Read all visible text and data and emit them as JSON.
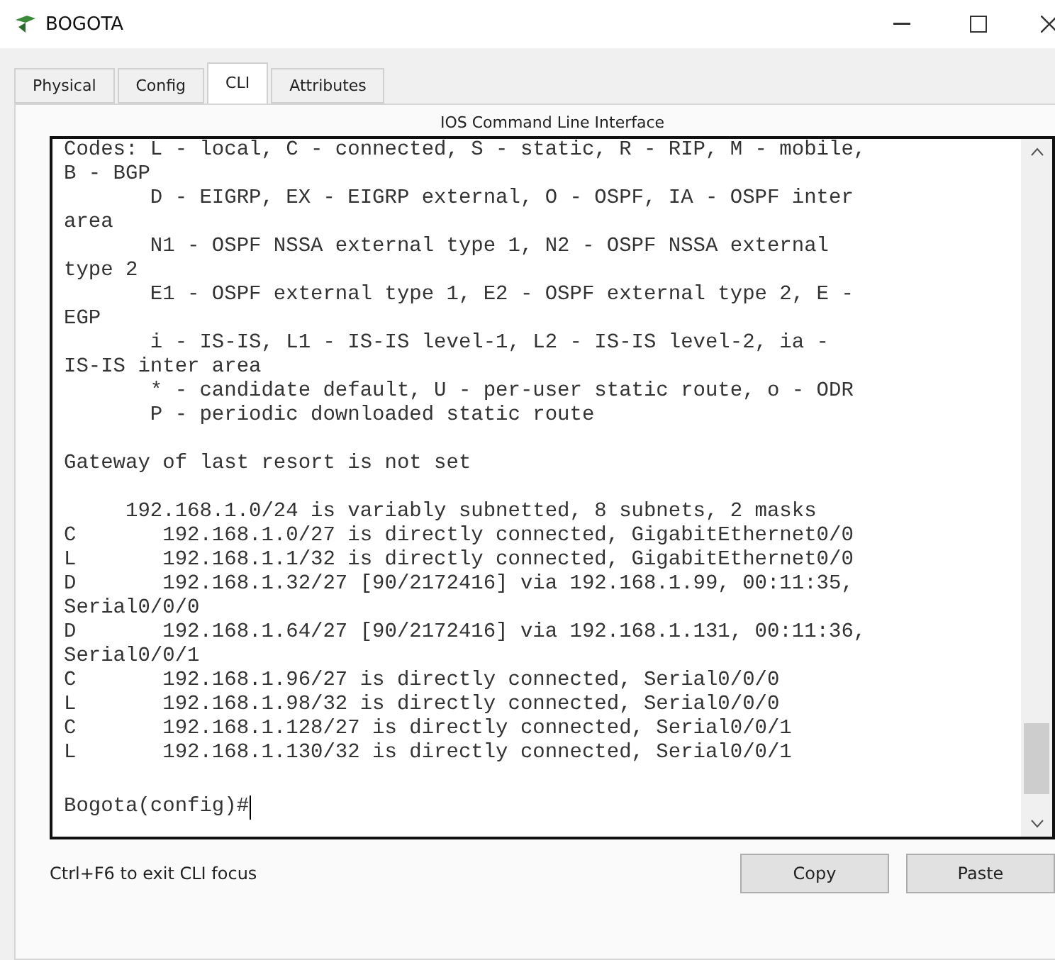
{
  "window": {
    "title": "BOGOTA"
  },
  "tabs": [
    {
      "label": "Physical",
      "selected": false
    },
    {
      "label": "Config",
      "selected": false
    },
    {
      "label": "CLI",
      "selected": true
    },
    {
      "label": "Attributes",
      "selected": false
    }
  ],
  "cli": {
    "heading": "IOS Command Line Interface",
    "lines": [
      "Codes: L - local, C - connected, S - static, R - RIP, M - mobile,",
      "B - BGP",
      "       D - EIGRP, EX - EIGRP external, O - OSPF, IA - OSPF inter",
      "area",
      "       N1 - OSPF NSSA external type 1, N2 - OSPF NSSA external",
      "type 2",
      "       E1 - OSPF external type 1, E2 - OSPF external type 2, E -",
      "EGP",
      "       i - IS-IS, L1 - IS-IS level-1, L2 - IS-IS level-2, ia -",
      "IS-IS inter area",
      "       * - candidate default, U - per-user static route, o - ODR",
      "       P - periodic downloaded static route",
      {
        "kind": "blank"
      },
      "Gateway of last resort is not set",
      {
        "kind": "blank"
      },
      "     192.168.1.0/24 is variably subnetted, 8 subnets, 2 masks",
      "C       192.168.1.0/27 is directly connected, GigabitEthernet0/0",
      "L       192.168.1.1/32 is directly connected, GigabitEthernet0/0",
      "D       192.168.1.32/27 [90/2172416] via 192.168.1.99, 00:11:35,",
      "Serial0/0/0",
      "D       192.168.1.64/27 [90/2172416] via 192.168.1.131, 00:11:36,",
      "Serial0/0/1",
      "C       192.168.1.96/27 is directly connected, Serial0/0/0",
      "L       192.168.1.98/32 is directly connected, Serial0/0/0",
      "C       192.168.1.128/27 is directly connected, Serial0/0/1",
      "L       192.168.1.130/32 is directly connected, Serial0/0/1",
      {
        "kind": "blank"
      }
    ],
    "prompt": "Bogota(config)#"
  },
  "footer": {
    "hint": "Ctrl+F6 to exit CLI focus",
    "buttons": [
      "Copy",
      "Paste"
    ]
  }
}
